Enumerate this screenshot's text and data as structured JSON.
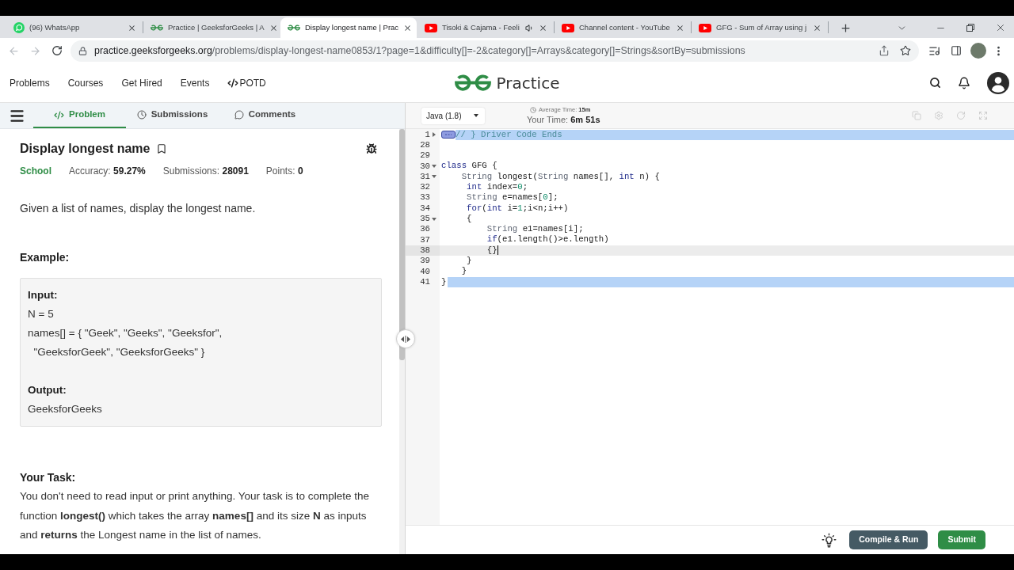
{
  "browser": {
    "tabs": [
      {
        "title": "(96) WhatsApp",
        "kind": "chat",
        "selected": false,
        "audio": false
      },
      {
        "title": "Practice | GeeksforGeeks | A",
        "kind": "site",
        "selected": false,
        "audio": false
      },
      {
        "title": "Display longest name | Prac",
        "kind": "site",
        "selected": true,
        "audio": false
      },
      {
        "title": "Tisoki & Cajama - Feeli",
        "kind": "video",
        "selected": false,
        "audio": true
      },
      {
        "title": "Channel content - YouTube",
        "kind": "video",
        "selected": false,
        "audio": false
      },
      {
        "title": "GFG - Sum of Array using j",
        "kind": "video",
        "selected": false,
        "audio": false
      }
    ],
    "back": {
      "disabled": true
    },
    "forward": {
      "disabled": true
    },
    "url": {
      "host": "practice.geeksforgeeks.org",
      "path": "/problems/display-longest-name0853/1?page=1&difficulty[]=-2&category[]=Arrays&category[]=Strings&sortBy=submissions"
    }
  },
  "site_header": {
    "nav": [
      {
        "label": "Problems",
        "kind": "link"
      },
      {
        "label": "Courses",
        "kind": "link"
      },
      {
        "label": "Get Hired",
        "kind": "link"
      },
      {
        "label": "Events",
        "kind": "link"
      },
      {
        "label": "POTD",
        "kind": "code"
      }
    ],
    "logo_text": "Practice"
  },
  "problem_panel": {
    "tabs": [
      {
        "label": "Problem",
        "kind": "code",
        "selected": true
      },
      {
        "label": "Submissions",
        "kind": "clock",
        "selected": false
      },
      {
        "label": "Comments",
        "kind": "comment",
        "selected": false
      }
    ],
    "title": "Display longest name",
    "difficulty": "School",
    "stats": [
      {
        "label": "Accuracy:",
        "value": "59.27%"
      },
      {
        "label": "Submissions:",
        "value": "28091"
      },
      {
        "label": "Points:",
        "value": "0"
      }
    ],
    "description": "Given a list of names, display the longest name.",
    "example_heading": "Example:",
    "example_lines": [
      {
        "kind": "heading",
        "text": "Input:"
      },
      {
        "kind": "text",
        "text": "N = 5"
      },
      {
        "kind": "text",
        "text": "names[] = { \"Geek\", \"Geeks\", \"Geeksfor\","
      },
      {
        "kind": "text",
        "text": "  \"GeeksforGeek\", \"GeeksforGeeks\" }"
      },
      {
        "kind": "heading",
        "text": "Output:"
      },
      {
        "kind": "text",
        "text": "GeeksforGeeks"
      }
    ],
    "task_heading": "Your Task:",
    "task_text": "You don't need to read input or print anything. Your task is to complete the function **longest()** which takes the array **names[]** and its size **N** as inputs and **returns** the Longest name in the list of names."
  },
  "editor": {
    "language": "Java (1.8)",
    "average_time": {
      "label": "Average Time:",
      "value": "15m"
    },
    "your_time": {
      "label": "Your Time:",
      "value": "6m 51s"
    },
    "lines": [
      {
        "number": "1",
        "foldable": true,
        "collapsed": true,
        "selected": true,
        "tail_selected": true,
        "active": false,
        "tokens": [
          {
            "kind": "comment",
            "text": "// } Driver Code Ends"
          }
        ]
      },
      {
        "number": "28",
        "foldable": false,
        "collapsed": false,
        "selected": false,
        "tail_selected": false,
        "active": false
      },
      {
        "number": "29",
        "foldable": false,
        "collapsed": false,
        "selected": false,
        "tail_selected": false,
        "active": false
      },
      {
        "number": "30",
        "foldable": true,
        "collapsed": false,
        "selected": false,
        "tail_selected": false,
        "active": false,
        "tokens": [
          {
            "kind": "keyword",
            "text": "class"
          },
          {
            "kind": "plain",
            "text": " GFG {"
          }
        ]
      },
      {
        "number": "31",
        "foldable": true,
        "collapsed": false,
        "selected": false,
        "tail_selected": false,
        "active": false,
        "tokens": [
          {
            "kind": "type",
            "text": "    String"
          },
          {
            "kind": "plain",
            "text": " longest("
          },
          {
            "kind": "type",
            "text": "String"
          },
          {
            "kind": "plain",
            "text": " names[], "
          },
          {
            "kind": "keyword",
            "text": "int"
          },
          {
            "kind": "plain",
            "text": " n) {"
          }
        ]
      },
      {
        "number": "32",
        "foldable": false,
        "collapsed": false,
        "selected": false,
        "tail_selected": false,
        "active": false,
        "tokens": [
          {
            "kind": "keyword",
            "text": "     int"
          },
          {
            "kind": "plain",
            "text": " index="
          },
          {
            "kind": "number",
            "text": "0"
          },
          {
            "kind": "plain",
            "text": ";"
          }
        ]
      },
      {
        "number": "33",
        "foldable": false,
        "collapsed": false,
        "selected": false,
        "tail_selected": false,
        "active": false,
        "tokens": [
          {
            "kind": "type",
            "text": "     String"
          },
          {
            "kind": "plain",
            "text": " e=names["
          },
          {
            "kind": "number",
            "text": "0"
          },
          {
            "kind": "plain",
            "text": "];"
          }
        ]
      },
      {
        "number": "34",
        "foldable": false,
        "collapsed": false,
        "selected": false,
        "tail_selected": false,
        "active": false,
        "tokens": [
          {
            "kind": "keyword",
            "text": "     for"
          },
          {
            "kind": "plain",
            "text": "("
          },
          {
            "kind": "keyword",
            "text": "int"
          },
          {
            "kind": "plain",
            "text": " i="
          },
          {
            "kind": "number",
            "text": "1"
          },
          {
            "kind": "plain",
            "text": ";i<n;i++)"
          }
        ]
      },
      {
        "number": "35",
        "foldable": true,
        "collapsed": false,
        "selected": false,
        "tail_selected": false,
        "active": false,
        "tokens": [
          {
            "kind": "plain",
            "text": "     {"
          }
        ]
      },
      {
        "number": "36",
        "foldable": false,
        "collapsed": false,
        "selected": false,
        "tail_selected": false,
        "active": false,
        "tokens": [
          {
            "kind": "type",
            "text": "         String"
          },
          {
            "kind": "plain",
            "text": " e1=names[i];"
          }
        ]
      },
      {
        "number": "37",
        "foldable": false,
        "collapsed": false,
        "selected": false,
        "tail_selected": false,
        "active": false,
        "tokens": [
          {
            "kind": "keyword",
            "text": "         if"
          },
          {
            "kind": "plain",
            "text": "(e1.length()>e.length)"
          }
        ]
      },
      {
        "number": "38",
        "foldable": false,
        "collapsed": false,
        "selected": false,
        "tail_selected": false,
        "active": true,
        "tokens": [
          {
            "kind": "plain",
            "text": "         {}"
          }
        ]
      },
      {
        "number": "39",
        "foldable": false,
        "collapsed": false,
        "selected": false,
        "tail_selected": false,
        "active": false,
        "tokens": [
          {
            "kind": "plain",
            "text": "     }"
          }
        ]
      },
      {
        "number": "40",
        "foldable": false,
        "collapsed": false,
        "selected": false,
        "tail_selected": false,
        "active": false,
        "tokens": [
          {
            "kind": "plain",
            "text": "    }"
          }
        ]
      },
      {
        "number": "41",
        "foldable": false,
        "collapsed": false,
        "selected": false,
        "tail_selected": true,
        "active": false,
        "tokens": [
          {
            "kind": "plain",
            "text": "}"
          }
        ]
      }
    ],
    "buttons": [
      {
        "label": "Compile & Run",
        "kind": "secondary"
      },
      {
        "label": "Submit",
        "kind": "primary"
      }
    ]
  }
}
